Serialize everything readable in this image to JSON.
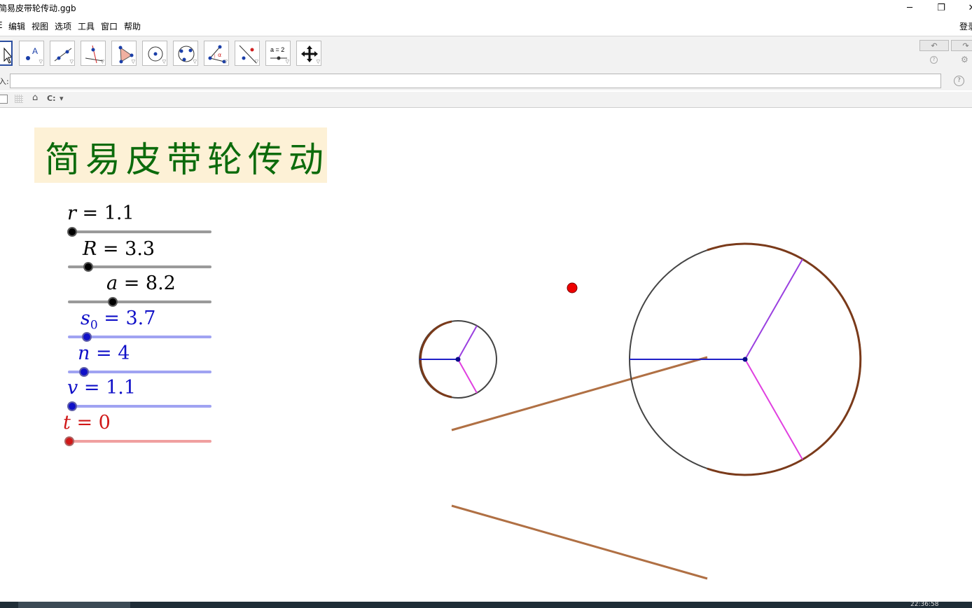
{
  "window": {
    "title": "简易皮带轮传动.ggb",
    "controls": {
      "minimize": "─",
      "restore": "❐",
      "close": "✕"
    }
  },
  "menu": {
    "file_fragment": "E",
    "items": [
      "编辑",
      "视图",
      "选项",
      "工具",
      "窗口",
      "帮助"
    ],
    "login_fragment": "登录"
  },
  "toolbar": {
    "tools": [
      {
        "name": "move-tool-icon",
        "selected": true
      },
      {
        "name": "point-tool-icon"
      },
      {
        "name": "line-tool-icon"
      },
      {
        "name": "perpendicular-line-tool-icon"
      },
      {
        "name": "polygon-tool-icon"
      },
      {
        "name": "circle-tool-icon"
      },
      {
        "name": "circle-three-points-tool-icon"
      },
      {
        "name": "angle-tool-icon"
      },
      {
        "name": "reflect-tool-icon"
      },
      {
        "name": "slider-tool-icon",
        "text": "a = 2"
      },
      {
        "name": "move-graphics-view-tool-icon"
      }
    ],
    "undo": "↶",
    "redo": "↷",
    "help_small": "?",
    "settings": "⚙"
  },
  "input_bar": {
    "label_fragment": "入:",
    "value": "",
    "help": "?"
  },
  "style_bar": {
    "home": "⌂",
    "capture": "C:",
    "dropdown": "▾"
  },
  "canvas": {
    "title": "简易皮带轮传动",
    "title_color": "#0c6b0c",
    "title_bg": "#fdf1d6",
    "sliders": [
      {
        "var": "r",
        "sub": "",
        "value": "1.1",
        "color": "#000000",
        "track": "#9a9a9a",
        "fraction": 0.03
      },
      {
        "var": "R",
        "sub": "",
        "value": "3.3",
        "color": "#000000",
        "track": "#9a9a9a",
        "fraction": 0.14
      },
      {
        "var": "a",
        "sub": "",
        "value": "8.2",
        "color": "#000000",
        "track": "#9a9a9a",
        "fraction": 0.31
      },
      {
        "var": "s",
        "sub": "0",
        "value": "3.7",
        "color": "#1010c8",
        "track": "#a0a3f2",
        "fraction": 0.13
      },
      {
        "var": "n",
        "sub": "",
        "value": "4",
        "color": "#1010c8",
        "track": "#a0a3f2",
        "fraction": 0.11
      },
      {
        "var": "v",
        "sub": "",
        "value": "1.1",
        "color": "#1010c8",
        "track": "#a0a3f2",
        "fraction": 0.03
      },
      {
        "var": "t",
        "sub": "",
        "value": "0",
        "color": "#d01818",
        "track": "#f0a0a0",
        "fraction": 0.0
      }
    ],
    "colors": {
      "belt": "#b07044",
      "wheel_arc": "#7a3a1a",
      "wheel_rim": "#444444",
      "spoke_blue": "#2020c8",
      "spoke_purple": "#9a40e0",
      "spoke_magenta": "#e040e0",
      "belt_point": "#ee0000"
    }
  },
  "taskbar": {
    "clock": "22:36:58"
  }
}
